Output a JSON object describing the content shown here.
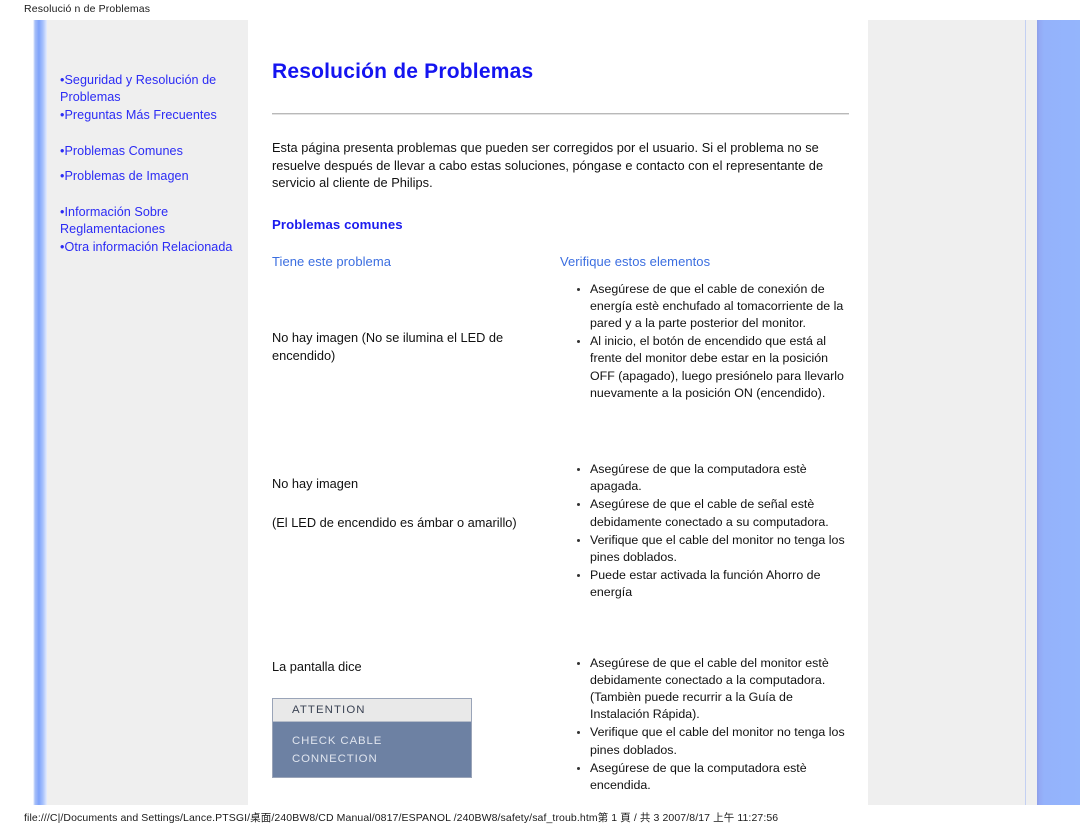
{
  "print": {
    "header": "Resolució n de Problemas",
    "footer": "file:///C|/Documents and Settings/Lance.PTSGI/桌面/240BW8/CD Manual/0817/ESPANOL /240BW8/safety/saf_troub.htm第 1 頁 / 共 3 2007/8/17 上午 11:27:56"
  },
  "sidebar": {
    "groups": [
      {
        "items": [
          "Seguridad y Resolución de Problemas",
          "Preguntas Más Frecuentes"
        ]
      },
      {
        "items": [
          "Problemas Comunes",
          "Problemas de Imagen"
        ]
      },
      {
        "items": [
          "Información Sobre Reglamentaciones",
          "Otra información Relacionada"
        ]
      }
    ]
  },
  "article": {
    "title": "Resolución de Problemas",
    "intro": "Esta página presenta problemas que pueden ser corregidos por el usuario. Si el problema no se resuelve después de llevar a cabo estas soluciones, póngase e contacto con el representante de servicio al cliente de Philips.",
    "section_heading": "Problemas comunes",
    "table": {
      "headers": {
        "problem": "Tiene este problema",
        "checks": "Verifique estos elementos"
      },
      "rows": [
        {
          "problem_line1": "No hay imagen (No se ilumina el LED de encendido)",
          "problem_line2": "",
          "checks": [
            "Asegúrese de que el cable de conexión de energía estè enchufado al tomacorriente de la pared y a la parte posterior del monitor.",
            "Al inicio, el botón de encendido que está al frente del monitor debe estar en la posición OFF (apagado), luego presiónelo para llevarlo nuevamente a la posición ON (encendido)."
          ]
        },
        {
          "problem_line1": "No hay imagen",
          "problem_line2": "(El LED de encendido es ámbar o amarillo)",
          "checks": [
            "Asegúrese de que la computadora estè apagada.",
            "Asegúrese de que el cable de señal estè debidamente conectado a su computadora.",
            "Verifique que el cable del monitor no tenga los pines doblados.",
            "Puede estar activada la función Ahorro de energía"
          ]
        },
        {
          "problem_line1": "La pantalla dice",
          "problem_line2": "",
          "checks": [
            "Asegúrese de que el cable del monitor estè debidamente conectado a la computadora. (Tambièn puede recurrir a la Guía de Instalación Rápida).",
            "Verifique que el cable del monitor no tenga los pines doblados.",
            "Asegúrese de que la computadora estè encendida."
          ]
        }
      ]
    },
    "osd": {
      "title": "ATTENTION",
      "message": "CHECK CABLE CONNECTION"
    }
  },
  "colors": {
    "link_blue": "#2b2bf5",
    "title_blue": "#1414f0",
    "header_blue": "#3b6ee0",
    "sidebar_gray": "#efefef",
    "osd_body": "#6d81a3",
    "osd_bar": "#e9e9e9",
    "accent_bar": "#94b5fc"
  }
}
